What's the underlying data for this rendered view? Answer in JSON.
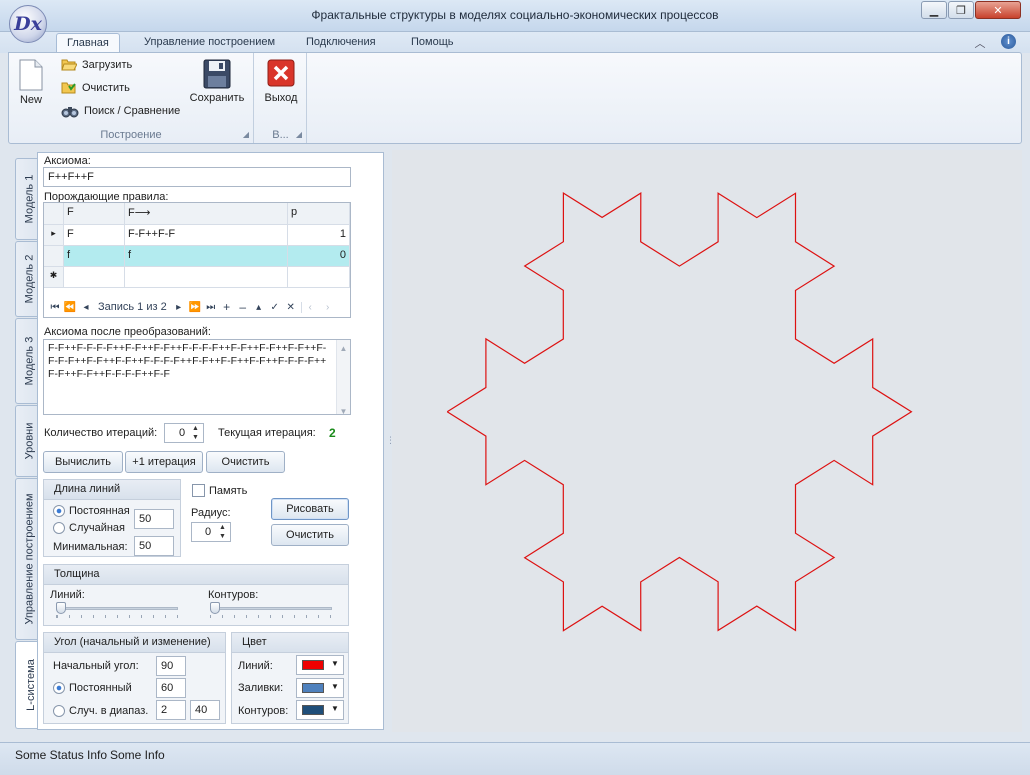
{
  "window": {
    "title": "Фрактальные структуры в моделях социально-экономических процессов",
    "logo_text": "Dx"
  },
  "ribbon": {
    "tabs": [
      {
        "label": "Главная",
        "active": true
      },
      {
        "label": "Управление построением",
        "active": false
      },
      {
        "label": "Подключения",
        "active": false
      },
      {
        "label": "Помощь",
        "active": false
      }
    ],
    "groups": {
      "build": {
        "label": "Построение",
        "new_label": "New",
        "load_label": "Загрузить",
        "clear_label": "Очистить",
        "search_label": "Поиск / Сравнение",
        "save_label": "Сохранить"
      },
      "exit": {
        "label": "В...",
        "exit_label": "Выход"
      }
    }
  },
  "side_tabs": [
    "Модель 1",
    "Модель 2",
    "Модель 3",
    "Уровни",
    "Управление построением",
    "L-система"
  ],
  "lsystem": {
    "axiom_label": "Аксиома:",
    "axiom_value": "F++F++F",
    "rules_label": "Порождающие правила:",
    "rules_columns": [
      "F",
      "F⟶",
      "p"
    ],
    "rules_rows": [
      {
        "marker": "▸",
        "symbol": "F",
        "replacement": "F-F++F-F",
        "p": "1"
      },
      {
        "marker": "",
        "symbol": "f",
        "replacement": "f",
        "p": "0"
      },
      {
        "marker": "✱",
        "symbol": "",
        "replacement": "",
        "p": ""
      }
    ],
    "navigator": {
      "record_text": "Запись 1 из 2",
      "icons": [
        "first-icon",
        "prev-page-icon",
        "prev-icon",
        "next-icon",
        "next-page-icon",
        "last-icon",
        "add-icon",
        "remove-icon",
        "up-icon",
        "check-icon",
        "cancel-icon"
      ]
    },
    "transformed_label": "Аксиома после преобразований:",
    "transformed_lines": [
      "F-F++F-F-F-F++F-F++F-F++F-F-F-F++F-F++F-F++F-F++F-",
      "F-F-F++F-F++F-F++F-F-F-F++F-F++F-F++F-F++F-F-F-F++",
      "F-F++F-F++F-F-F-F++F-F"
    ],
    "iterations_label": "Количество итераций:",
    "iterations_value": "0",
    "current_iteration_label": "Текущая итерация:",
    "current_iteration_value": "2",
    "buttons": {
      "compute": "Вычислить",
      "plus_one": "+1 итерация",
      "clear": "Очистить",
      "draw": "Рисовать",
      "clear_draw": "Очистить"
    },
    "line_length": {
      "title": "Длина линий",
      "constant_label": "Постоянная",
      "random_label": "Случайная",
      "constant_value": "50",
      "min_label": "Минимальная:",
      "min_value": "50",
      "selected": "constant"
    },
    "memory_label": "Память",
    "memory_checked": false,
    "radius_label": "Радиус:",
    "radius_value": "0",
    "thickness": {
      "title": "Толщина",
      "lines_label": "Линий:",
      "contours_label": "Контуров:",
      "lines_level": 0,
      "contours_level": 0
    },
    "angle": {
      "title": "Угол (начальный и изменение)",
      "start_label": "Начальный угол:",
      "start_value": "90",
      "constant_label": "Постоянный",
      "constant_value": "60",
      "random_label": "Случ. в диапаз.",
      "range_from": "2",
      "range_to": "40",
      "selected": "constant"
    },
    "color": {
      "title": "Цвет",
      "lines_label": "Линий:",
      "fill_label": "Заливки:",
      "contours_label": "Контуров:",
      "lines_color": "#ee0000",
      "fill_color": "#4f81bd",
      "contours_color": "#1f4e79"
    }
  },
  "fractal": {
    "type": "Koch snowflake",
    "stroke_color": "#dd1111"
  },
  "status": {
    "items": [
      "Some Status Info",
      "Some Info"
    ]
  }
}
